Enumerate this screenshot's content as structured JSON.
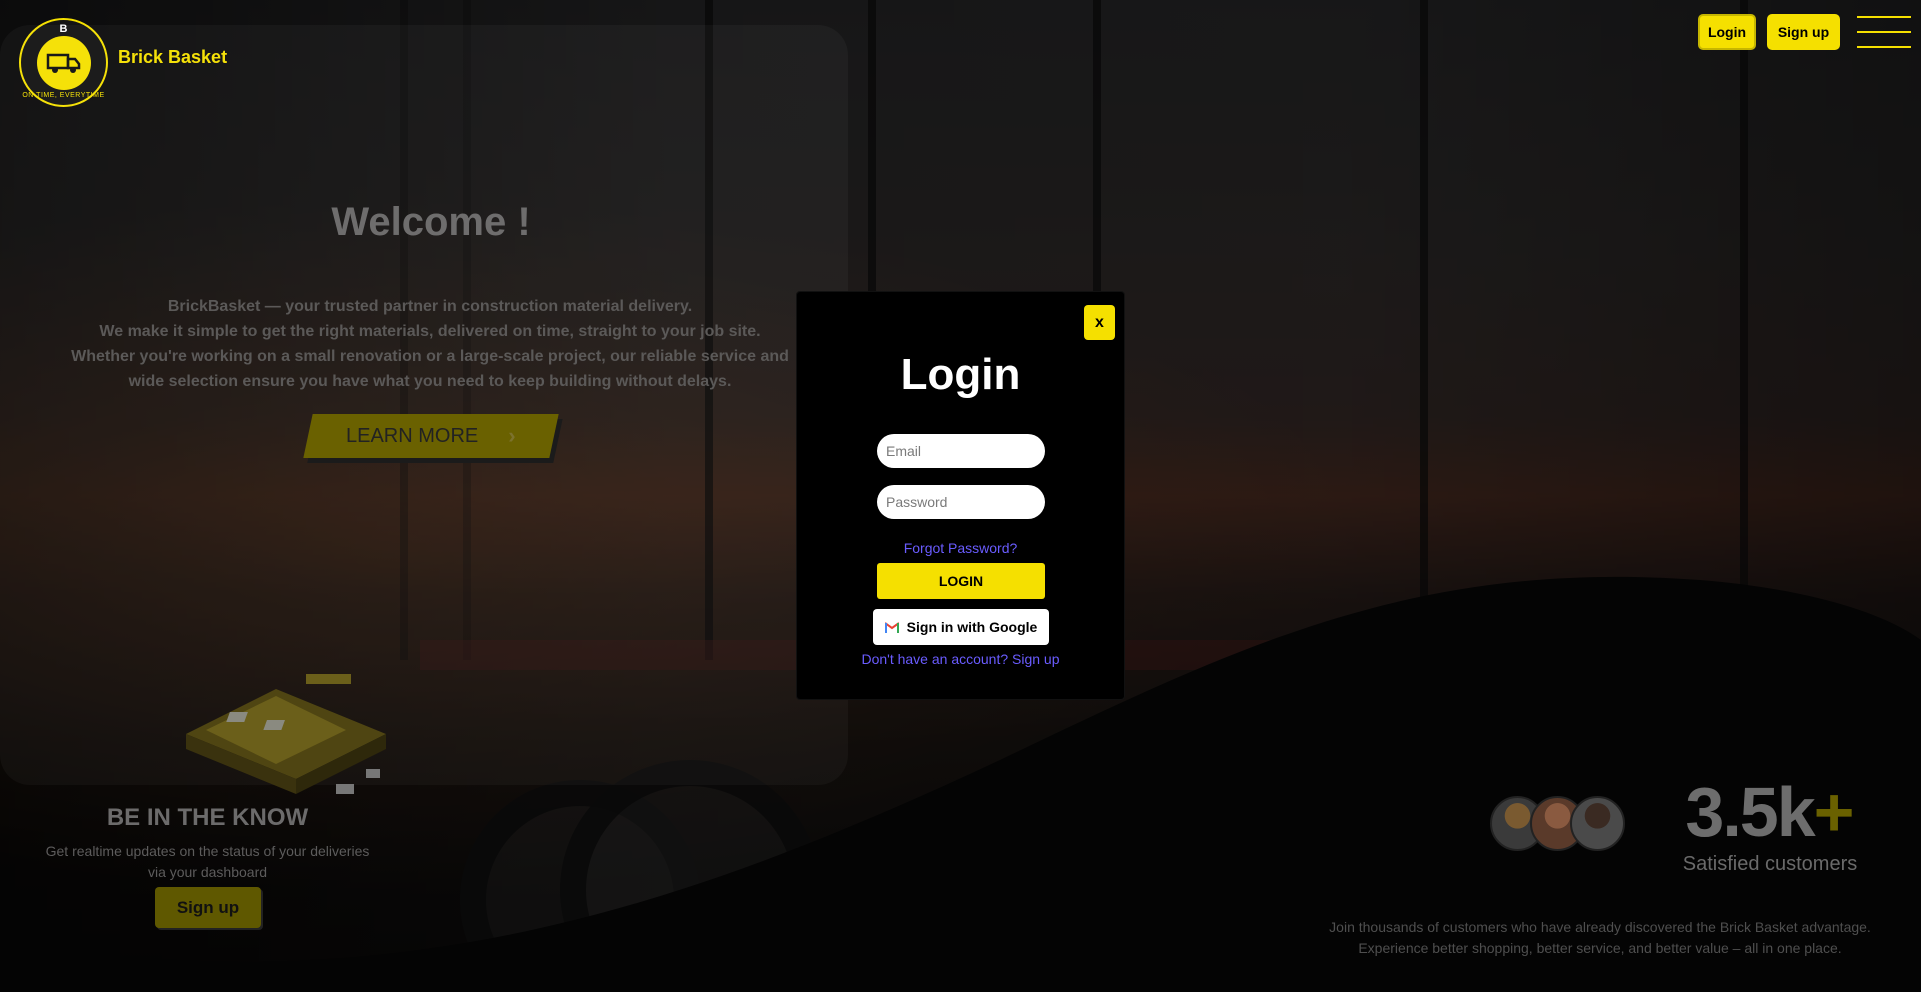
{
  "header": {
    "logo_letter": "B",
    "logo_tagline": "ON TIME, EVERYTIME",
    "brand_name": "Brick Basket",
    "login_label": "Login",
    "signup_label": "Sign up",
    "menu_icon": "hamburger-menu-icon"
  },
  "hero": {
    "welcome": "Welcome !",
    "lines": [
      "BrickBasket — your trusted partner in construction material delivery.",
      "We make it simple to get the right materials, delivered on time, straight to your job site.",
      "Whether you're working on a small renovation or a large-scale project, our reliable service and",
      "wide selection ensure you have what you need to keep building without delays."
    ],
    "learn_more": "LEARN MORE",
    "learn_more_icon": "chevron-right-icon"
  },
  "know": {
    "title": "BE IN THE KNOW",
    "line1": "Get realtime updates on the status of your deliveries",
    "line2": "via your dashboard",
    "signup_label": "Sign up"
  },
  "stats": {
    "count": "3.5k",
    "plus": "+",
    "label": "Satisfied customers",
    "join_line1": "Join thousands of customers who have already discovered the Brick Basket advantage.",
    "join_line2": "Experience better shopping, better service, and better value – all in one place."
  },
  "modal": {
    "close_label": "x",
    "title": "Login",
    "email_placeholder": "Email",
    "password_placeholder": "Password",
    "forgot": "Forgot Password?",
    "login_label": "LOGIN",
    "google_label": "Sign in with Google",
    "signup_prompt": "Don't have an account? Sign up"
  },
  "colors": {
    "accent": "#f5e000",
    "link": "#6a5cff",
    "modal_bg": "#000000"
  }
}
